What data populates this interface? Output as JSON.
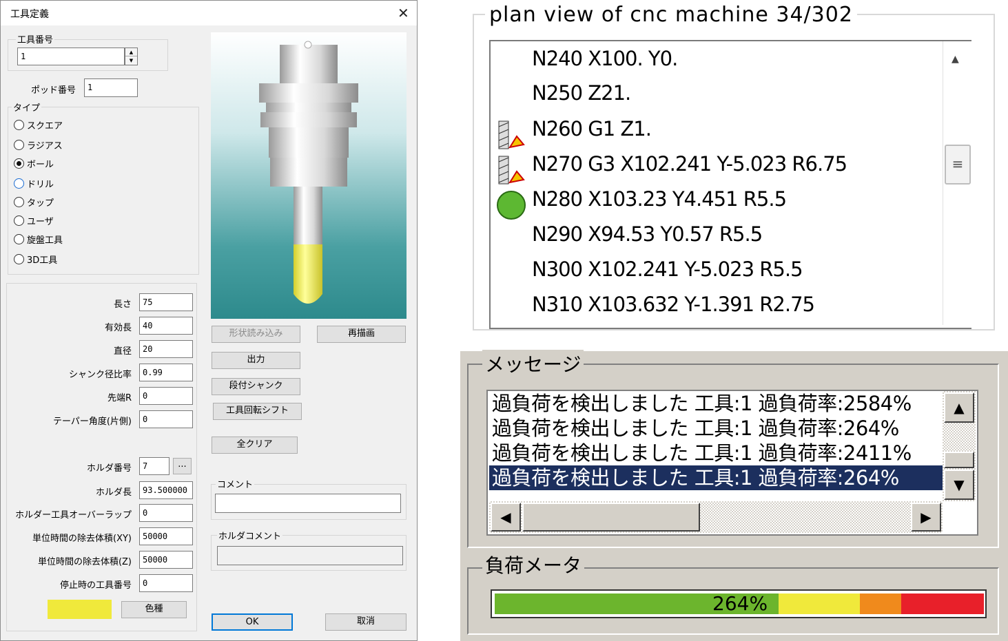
{
  "dialog": {
    "title": "工具定義",
    "close_glyph": "✕",
    "tool_number": {
      "label": "工具番号",
      "value": "1"
    },
    "pod_number": {
      "label": "ポッド番号",
      "value": "1"
    },
    "type": {
      "label": "タイプ",
      "options": [
        "スクエア",
        "ラジアス",
        "ボール",
        "ドリル",
        "タップ",
        "ユーザ",
        "旋盤工具",
        "3D工具"
      ],
      "selected": "ボール"
    },
    "params": [
      {
        "label": "長さ",
        "value": "75"
      },
      {
        "label": "有効長",
        "value": "40"
      },
      {
        "label": "直径",
        "value": "20"
      },
      {
        "label": "シャンク径比率",
        "value": "0.99"
      },
      {
        "label": "先端R",
        "value": "0"
      },
      {
        "label": "テーパー角度(片側)",
        "value": "0"
      }
    ],
    "holder_params": [
      {
        "label": "ホルダ番号",
        "value": "7"
      },
      {
        "label": "ホルダ長",
        "value": "93.500000"
      },
      {
        "label": "ホルダー工具オーバーラップ",
        "value": "0"
      },
      {
        "label": "単位時間の除去体積(XY)",
        "value": "50000"
      },
      {
        "label": "単位時間の除去体積(Z)",
        "value": "50000"
      },
      {
        "label": "停止時の工具番号",
        "value": "0"
      }
    ],
    "browse_label": "...",
    "color_swatch": "#f0e93b",
    "buttons": {
      "load_shape": "形状読み込み",
      "redraw": "再描画",
      "output": "出力",
      "stepped_shank": "段付シャンク",
      "tool_rotation_shift": "工具回転シフト",
      "clear_all": "全クリア",
      "color": "色種",
      "ok": "OK",
      "cancel": "取消"
    },
    "comment_label": "コメント",
    "comment_value": "",
    "holder_comment_label": "ホルダコメント",
    "holder_comment_value": ""
  },
  "nc_view": {
    "title": "plan view of cnc machine 34/302",
    "lines": [
      {
        "text": "N240  X100. Y0.",
        "icon": ""
      },
      {
        "text": "N250  Z21.",
        "icon": ""
      },
      {
        "text": "N260 G1 Z1.",
        "icon": "cutting-tool-icon"
      },
      {
        "text": "N270 G3 X102.241 Y-5.023 R6.75",
        "icon": "cutting-tool-icon"
      },
      {
        "text": "N280 X103.23 Y4.451 R5.5",
        "icon": "green-circle-icon"
      },
      {
        "text": "N290 X94.53 Y0.57 R5.5",
        "icon": ""
      },
      {
        "text": "N300 X102.241 Y-5.023 R5.5",
        "icon": ""
      },
      {
        "text": "N310 X103.632 Y-1.391 R2.75",
        "icon": ""
      }
    ]
  },
  "messages": {
    "label": "メッセージ",
    "items": [
      "過負荷を検出しました 工具:1 過負荷率:2584%",
      "過負荷を検出しました 工具:1 過負荷率:264%",
      "過負荷を検出しました 工具:1 過負荷率:2411%",
      "過負荷を検出しました 工具:1 過負荷率:264%"
    ],
    "selected_index": 3
  },
  "load_meter": {
    "label": "負荷メータ",
    "value_text": "264%",
    "colors": {
      "green": "#6cb52d",
      "yellow": "#f0e93b",
      "orange": "#f08a1c",
      "red": "#e8202a"
    }
  },
  "colors": {
    "selection": "#1c2f5e",
    "nc_green": "#5db832"
  }
}
